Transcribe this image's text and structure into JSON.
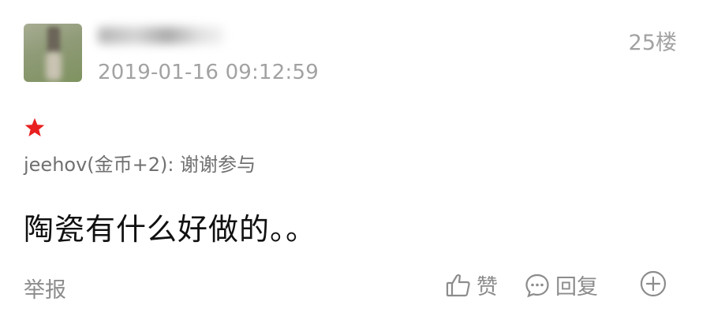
{
  "post": {
    "timestamp": "2019-01-16 09:12:59",
    "floor": "25楼",
    "reward_note": "jeehov(金币+2): 谢谢参与",
    "content": "陶瓷有什么好做的。。"
  },
  "actions": {
    "report_label": "举报",
    "like_label": "赞",
    "reply_label": "回复"
  },
  "icons": {
    "star": "star-icon",
    "like": "thumbs-up-icon",
    "reply": "comment-bubble-icon",
    "more": "plus-circle-icon"
  },
  "colors": {
    "star": "#e8201f",
    "meta_text": "#a2a2a2",
    "content_text": "#111111"
  }
}
